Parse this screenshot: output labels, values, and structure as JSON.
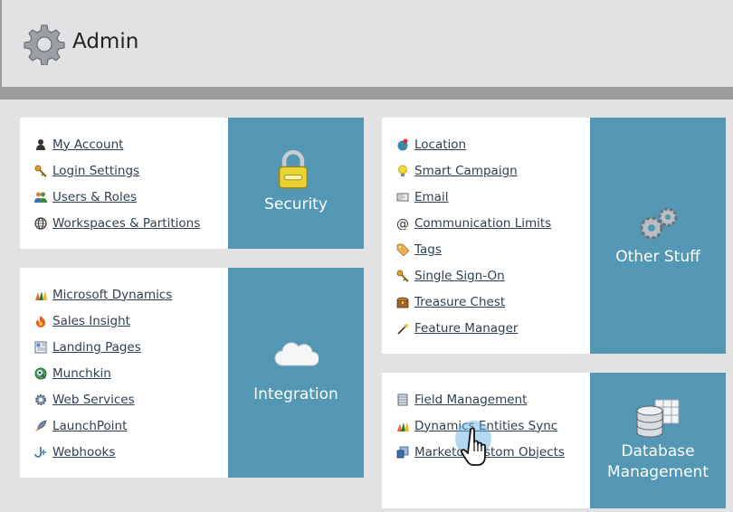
{
  "header": {
    "title": "Admin",
    "icon": "gear-icon"
  },
  "security": {
    "tile_label": "Security",
    "tile_icon": "padlock-icon",
    "links": [
      {
        "label": "My Account",
        "icon": "user-icon"
      },
      {
        "label": "Login Settings",
        "icon": "key-icon"
      },
      {
        "label": "Users & Roles",
        "icon": "users-icon"
      },
      {
        "label": "Workspaces & Partitions",
        "icon": "globe-icon"
      }
    ]
  },
  "integration": {
    "tile_label": "Integration",
    "tile_icon": "cloud-icon",
    "links": [
      {
        "label": "Microsoft Dynamics",
        "icon": "dynamics-icon"
      },
      {
        "label": "Sales Insight",
        "icon": "flame-icon"
      },
      {
        "label": "Landing Pages",
        "icon": "page-icon"
      },
      {
        "label": "Munchkin",
        "icon": "munchkin-icon"
      },
      {
        "label": "Web Services",
        "icon": "cog-icon"
      },
      {
        "label": "LaunchPoint",
        "icon": "rocket-icon"
      },
      {
        "label": "Webhooks",
        "icon": "hook-icon"
      }
    ]
  },
  "other": {
    "tile_label": "Other Stuff",
    "tile_icon": "gears-icon",
    "links": [
      {
        "label": "Location",
        "icon": "location-icon"
      },
      {
        "label": "Smart Campaign",
        "icon": "lightbulb-icon"
      },
      {
        "label": "Email",
        "icon": "email-icon"
      },
      {
        "label": "Communication Limits",
        "icon": "at-icon"
      },
      {
        "label": "Tags",
        "icon": "tag-icon"
      },
      {
        "label": "Single Sign-On",
        "icon": "key-icon"
      },
      {
        "label": "Treasure Chest",
        "icon": "chest-icon"
      },
      {
        "label": "Feature Manager",
        "icon": "wand-icon"
      }
    ]
  },
  "database": {
    "tile_label_line1": "Database",
    "tile_label_line2": "Management",
    "tile_icon": "database-icon",
    "links": [
      {
        "label": "Field Management",
        "icon": "field-icon"
      },
      {
        "label": "Dynamics Entities Sync",
        "icon": "dynamics-icon"
      },
      {
        "label": "Marketo Custom Objects",
        "icon": "objects-icon"
      }
    ]
  },
  "colors": {
    "tile": "#5397b4",
    "link": "#2e3f52",
    "background": "#e2e2e4"
  }
}
